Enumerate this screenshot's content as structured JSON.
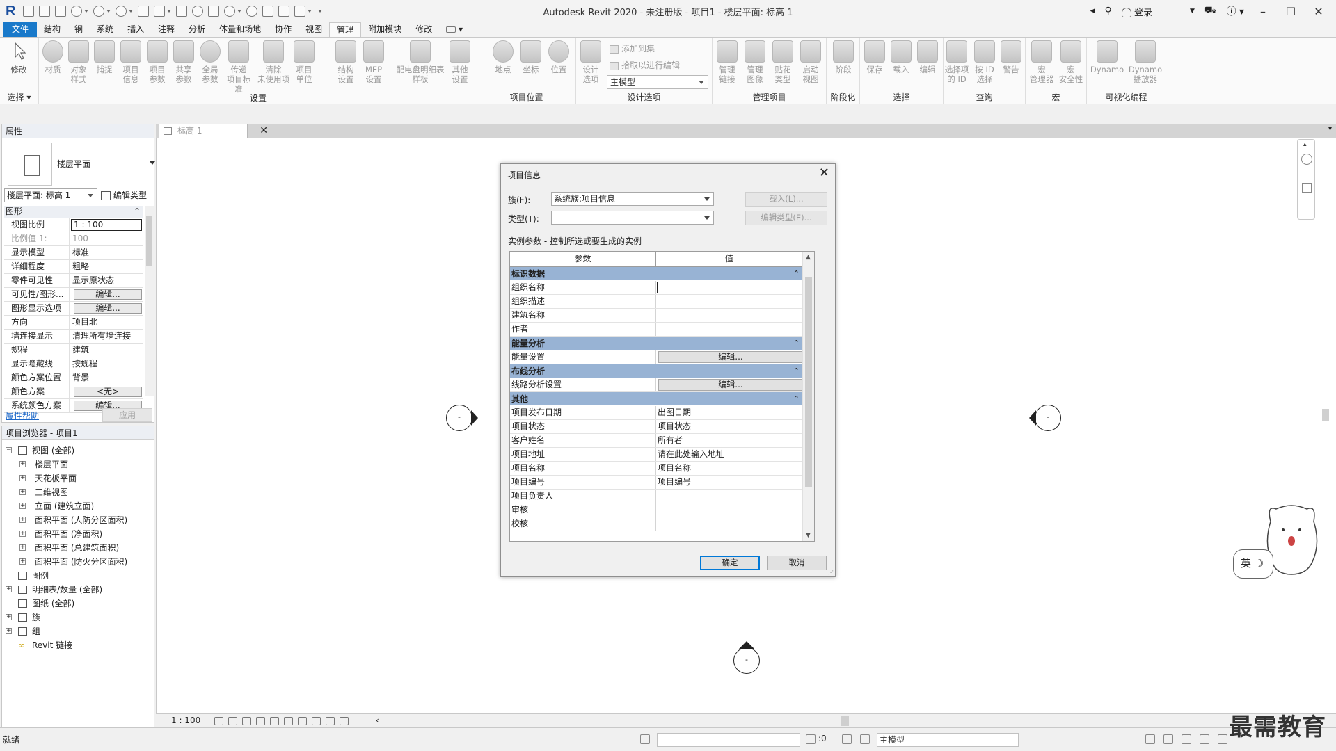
{
  "window": {
    "title": "Autodesk Revit 2020 - 未注册版 - 项目1 - 楼层平面: 标高 1",
    "logo": "R",
    "login": "登录"
  },
  "menu": [
    "文件",
    "结构",
    "钢",
    "系统",
    "插入",
    "注释",
    "分析",
    "体量和场地",
    "协作",
    "视图",
    "管理",
    "附加模块",
    "修改"
  ],
  "menu_active": "管理",
  "ribbon": {
    "groups": {
      "select": "选择",
      "settings": "设置",
      "project_location": "项目位置",
      "design_options": "设计选项",
      "manage_project": "管理项目",
      "phasing": "阶段化",
      "selection": "选择",
      "inquiry": "查询",
      "macros": "宏",
      "visual_programming": "可视化编程"
    },
    "buttons": {
      "modify": "修改",
      "materials": "材质",
      "object_styles_1": "对象",
      "object_styles_2": "样式",
      "snaps": "捕捉",
      "project_info_1": "项目",
      "project_info_2": "信息",
      "project_params_1": "项目",
      "project_params_2": "参数",
      "shared_params_1": "共享",
      "shared_params_2": "参数",
      "global_params_1": "全局",
      "global_params_2": "参数",
      "transfer_1": "传递",
      "transfer_2": "项目标准",
      "purge_1": "清除",
      "purge_2": "未使用项",
      "units_1": "项目",
      "units_2": "单位",
      "struct_1": "结构",
      "struct_2": "设置",
      "mep_1": "MEP",
      "mep_2": "设置",
      "panel_sched_1": "配电盘明细表",
      "panel_sched_2": "样板",
      "other_1": "其他",
      "other_2": "设置",
      "location": "地点",
      "coordinates": "坐标",
      "position": "位置",
      "design_opts_1": "设计",
      "design_opts_2": "选项",
      "add_to_set": "添加到集",
      "pick_to_edit": "拾取以进行编辑",
      "main_model": "主模型",
      "manage_links_1": "管理",
      "manage_links_2": "链接",
      "manage_images_1": "管理",
      "manage_images_2": "图像",
      "decal_1": "贴花",
      "decal_2": "类型",
      "starting_view_1": "启动",
      "starting_view_2": "视图",
      "phases": "阶段",
      "save": "保存",
      "load": "载入",
      "edit": "编辑",
      "select_by_id_1": "选择项",
      "select_by_id_2": "的 ID",
      "by_id_1": "按 ID",
      "by_id_2": "选择",
      "warnings": "警告",
      "macro_mgr_1": "宏",
      "macro_mgr_2": "管理器",
      "macro_sec_1": "宏",
      "macro_sec_2": "安全性",
      "dynamo": "Dynamo",
      "dynamo_player_1": "Dynamo",
      "dynamo_player_2": "播放器"
    }
  },
  "properties": {
    "title": "属性",
    "type_name": "楼层平面",
    "instance_selector": "楼层平面: 标高 1",
    "edit_type": "编辑类型",
    "section": "图形",
    "rows": [
      {
        "k": "视图比例",
        "v": "1 : 100"
      },
      {
        "k": "比例值 1:",
        "v": "100"
      },
      {
        "k": "显示模型",
        "v": "标准"
      },
      {
        "k": "详细程度",
        "v": "粗略"
      },
      {
        "k": "零件可见性",
        "v": "显示原状态"
      },
      {
        "k": "可见性/图形...",
        "v": "编辑..."
      },
      {
        "k": "图形显示选项",
        "v": "编辑..."
      },
      {
        "k": "方向",
        "v": "项目北"
      },
      {
        "k": "墙连接显示",
        "v": "清理所有墙连接"
      },
      {
        "k": "规程",
        "v": "建筑"
      },
      {
        "k": "显示隐藏线",
        "v": "按规程"
      },
      {
        "k": "颜色方案位置",
        "v": "背景"
      },
      {
        "k": "颜色方案",
        "v": "<无>"
      },
      {
        "k": "系统颜色方案",
        "v": "编辑..."
      }
    ],
    "help": "属性帮助",
    "apply": "应用"
  },
  "browser": {
    "title": "项目浏览器 - 项目1",
    "nodes": [
      "视图 (全部)",
      "楼层平面",
      "天花板平面",
      "三维视图",
      "立面 (建筑立面)",
      "面积平面 (人防分区面积)",
      "面积平面 (净面积)",
      "面积平面 (总建筑面积)",
      "面积平面 (防火分区面积)",
      "图例",
      "明细表/数量 (全部)",
      "图纸 (全部)",
      "族",
      "组",
      "Revit 链接"
    ]
  },
  "view": {
    "tab": "标高 1",
    "scale": "1 : 100",
    "elevation_mark": "-"
  },
  "dialog": {
    "title": "项目信息",
    "family_label": "族(F):",
    "family_value": "系统族:项目信息",
    "type_label": "类型(T):",
    "type_value": "",
    "load_btn": "载入(L)...",
    "edit_type_btn": "编辑类型(E)...",
    "instance_params": "实例参数 - 控制所选或要生成的实例",
    "col_param": "参数",
    "col_value": "值",
    "groups": [
      {
        "name": "标识数据",
        "rows": [
          {
            "k": "组织名称",
            "v": ""
          },
          {
            "k": "组织描述",
            "v": ""
          },
          {
            "k": "建筑名称",
            "v": ""
          },
          {
            "k": "作者",
            "v": ""
          }
        ]
      },
      {
        "name": "能量分析",
        "rows": [
          {
            "k": "能量设置",
            "v": "编辑..."
          }
        ]
      },
      {
        "name": "布线分析",
        "rows": [
          {
            "k": "线路分析设置",
            "v": "编辑..."
          }
        ]
      },
      {
        "name": "其他",
        "rows": [
          {
            "k": "项目发布日期",
            "v": "出图日期"
          },
          {
            "k": "项目状态",
            "v": "项目状态"
          },
          {
            "k": "客户姓名",
            "v": "所有者"
          },
          {
            "k": "项目地址",
            "v": "请在此处输入地址"
          },
          {
            "k": "项目名称",
            "v": "项目名称"
          },
          {
            "k": "项目编号",
            "v": "项目编号"
          },
          {
            "k": "项目负责人",
            "v": ""
          },
          {
            "k": "审核",
            "v": ""
          },
          {
            "k": "校核",
            "v": ""
          }
        ]
      }
    ],
    "ok": "确定",
    "cancel": "取消"
  },
  "status": {
    "text": "就绪",
    "zero": ":0",
    "model": "主模型"
  },
  "mascot": {
    "ime": "英"
  },
  "watermark": "最需教育",
  "colors": {
    "file_tab": "#1979ca",
    "group_header": "#98b3d4",
    "accent": "#0078d7"
  }
}
